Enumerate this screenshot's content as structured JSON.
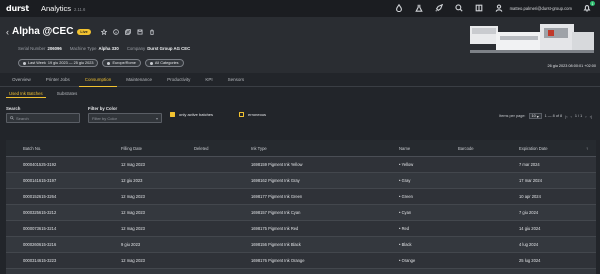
{
  "app": {
    "logo": "durst",
    "name": "Analytics",
    "version": "2.11.6"
  },
  "user": {
    "email": "matteo.palmeri@durst-group.com",
    "notifications": "1"
  },
  "top_icons": [
    "drop-icon",
    "flask-icon",
    "rocket-icon",
    "search-icon",
    "book-icon",
    "user-icon",
    "bell-icon"
  ],
  "header": {
    "back_glyph": "‹",
    "title": "Alpha @CEC",
    "badge": "Live",
    "meta": [
      {
        "label": "Serial Number",
        "value": "206096"
      },
      {
        "label": "Machine Type",
        "value": "Alpha 330"
      },
      {
        "label": "Company",
        "value": "Durst Group AG CEC"
      }
    ],
    "chips": [
      {
        "label": "Last Week",
        "value": "19 giu 2023 — 25 giu 2023"
      },
      {
        "label": "Europe/Rome",
        "value": ""
      },
      {
        "label": "All Categories",
        "value": ""
      }
    ],
    "timestamp": "26 giu 2023 08:00:01 +02:00"
  },
  "nav_tabs": [
    "Overview",
    "Printer Jobs",
    "Consumption",
    "Maintenance",
    "Productivity",
    "KPI",
    "Sensors"
  ],
  "active_nav": "Consumption",
  "sub_tabs": [
    "Used Ink Batches",
    "Substrates"
  ],
  "active_sub": "Used Ink Batches",
  "filters": {
    "search_label": "Search",
    "search_placeholder": "Search",
    "color_label": "Filter by Color",
    "color_placeholder": "Filter by Color",
    "only_active_label": "only active batches",
    "only_active_checked": true,
    "erroneous_label": "erroneous",
    "erroneous_checked": false
  },
  "pagination": {
    "items_label": "Items per page:",
    "items_value": "10",
    "range": "1 — 8 of 8",
    "page": "1 / 1"
  },
  "table": {
    "columns": [
      "Batch No.",
      "Filling Date",
      "Deleted",
      "Ink Type",
      "Name",
      "Barcode",
      "Expiration Date"
    ],
    "rows": [
      [
        "0000401525-3192",
        "12 mag 2023",
        "",
        "1698159 Pigment Ink Yellow",
        "Yellow",
        "",
        "7 mar 2024"
      ],
      [
        "0000141615-3197",
        "12 giu 2023",
        "",
        "1698162 Pigment Ink Gray",
        "Gray",
        "",
        "17 mar 2024"
      ],
      [
        "0000152615-3264",
        "12 mag 2023",
        "",
        "1698177 Pigment Ink Green",
        "Green",
        "",
        "10 apr 2024"
      ],
      [
        "0000325615-3212",
        "12 mag 2023",
        "",
        "1698157 Pigment Ink Cyan",
        "Cyan",
        "",
        "7 giu 2024"
      ],
      [
        "0000073615-3214",
        "12 mag 2023",
        "",
        "1698175 Pigment Ink Red",
        "Red",
        "",
        "14 giu 2024"
      ],
      [
        "0000260615-3216",
        "9 giu 2023",
        "",
        "1698156 Pigment Ink Black",
        "Black",
        "",
        "4 lug 2024"
      ],
      [
        "0000314615-3223",
        "12 mag 2023",
        "",
        "1698176 Pigment Ink Orange",
        "Orange",
        "",
        "25 lug 2024"
      ],
      [
        "0000427525-3244",
        "12 giu 2023",
        "",
        "1698168 Pigment Ink Magenta",
        "Magenta",
        "",
        "25 set 2024"
      ]
    ]
  }
}
